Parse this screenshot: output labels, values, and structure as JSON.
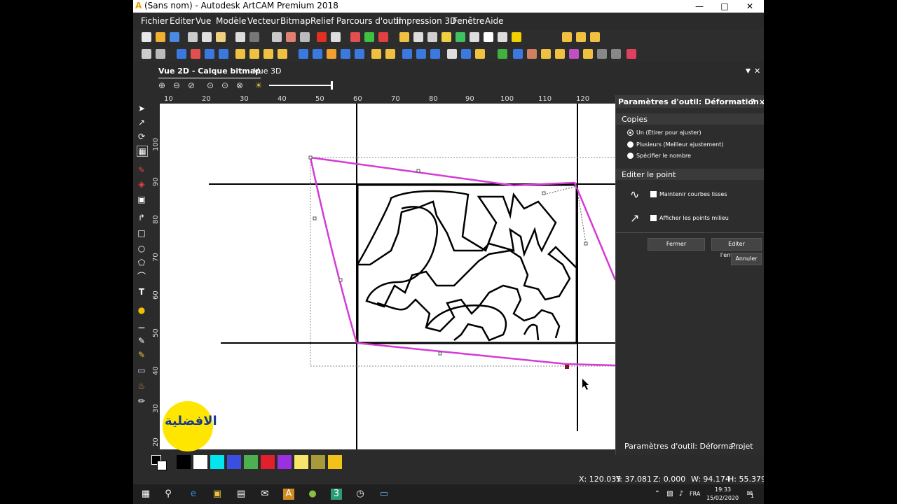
{
  "window": {
    "title": "(Sans nom) - Autodesk ArtCAM Premium 2018",
    "app_icon": "A",
    "controls": [
      "minimize-icon",
      "maximize-icon",
      "close-icon"
    ]
  },
  "menu": [
    "Fichier",
    "Editer",
    "Vue",
    "Modèle",
    "Vecteur",
    "Bitmap",
    "Relief",
    "Parcours d'outil",
    "Impression 3D",
    "Fenêtre",
    "Aide"
  ],
  "tabs": {
    "active": "Vue 2D - Calque bitmap",
    "other": "Vue 3D"
  },
  "ruler": {
    "h_ticks": [
      "10",
      "20",
      "30",
      "40",
      "50",
      "60",
      "70",
      "80",
      "90",
      "100",
      "110",
      "120"
    ],
    "v_ticks": [
      "100",
      "90",
      "80",
      "70",
      "60",
      "50",
      "40",
      "30",
      "20"
    ]
  },
  "panel": {
    "title": "Paramètres d'outil: Déformation ...",
    "help": "?",
    "close": "×",
    "copies_header": "Copies",
    "copies_options": [
      "Un (Etirer pour ajuster)",
      "Plusieurs (Meilleur ajustement)",
      "Spécifier le nombre"
    ],
    "edit_header": "Editer le point",
    "check_smooth": "Maintenir courbes lisses",
    "check_midpoints": "Afficher les points milieu",
    "btn_close": "Fermer",
    "btn_envelope": "Editer l'enveloppe",
    "btn_cancel": "Annuler",
    "bottom_tab_1": "Paramètres d'outil: Déforma...",
    "bottom_tab_2": "Projet"
  },
  "palette": [
    "#000000",
    "#ffffff",
    "#00e5ee",
    "#3a4fe0",
    "#4caf50",
    "#e0202a",
    "#9b30e0",
    "#f5e66a",
    "#a89a3a",
    "#f2c21a"
  ],
  "status": {
    "x": "X: 120.035",
    "y": "Y: 37.081",
    "z": "Z: 0.000",
    "w": "W: 94.174",
    "h": "H: 55.379"
  },
  "taskbar": {
    "lang": "FRA",
    "time": "19:33",
    "date": "15/02/2020",
    "notif": "1"
  },
  "logo_text": "الافضلية"
}
